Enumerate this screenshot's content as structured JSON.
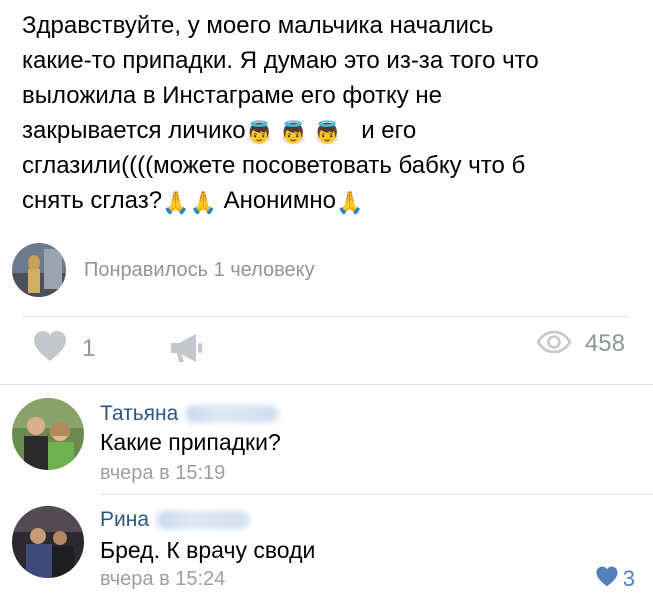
{
  "post": {
    "lines": [
      "Здравствуйте, у моего мальчика начались",
      "какие-то припадки. Я думаю это из-за того что",
      "выложила в Инстаграме его фотку не",
      "закрывается личико",
      "и его",
      "сглазили((((можете посоветовать бабку что б",
      "снять сглаз?",
      "Анонимно"
    ],
    "emoji_baby_angel": "👼",
    "emoji_pray": "🙏"
  },
  "liked": {
    "text": "Понравилось 1 человеку"
  },
  "actions": {
    "like_count": "1",
    "views_count": "458"
  },
  "comments": [
    {
      "name": "Татьяна",
      "text": "Какие припадки?",
      "time": "вчера в 15:19"
    },
    {
      "name": "Рина",
      "text": "Бред. К врачу своди",
      "time": "вчера в 15:24",
      "likes": "3"
    }
  ],
  "colors": {
    "link": "#2a5885",
    "muted": "#8e959c",
    "accent": "#5181b8",
    "icon_gray": "#c4c8cd"
  }
}
